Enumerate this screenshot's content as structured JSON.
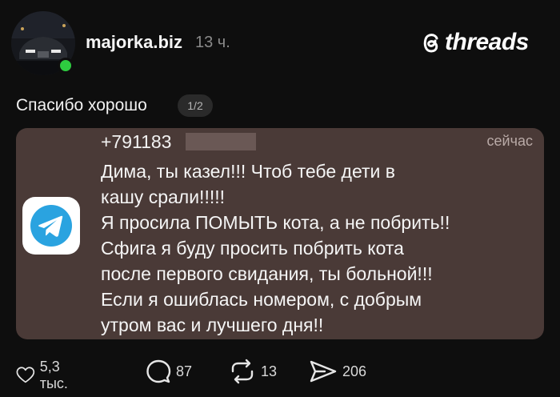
{
  "post": {
    "username": "majorka.biz",
    "time_ago": "13 ч.",
    "text": "Спасибо хорошо",
    "page_indicator": "1/2"
  },
  "brand": {
    "name": "threads"
  },
  "notification": {
    "app_icon": "telegram-icon",
    "sender": "+791183",
    "time": "сейчас",
    "message_lines": [
      "Дима, ты казел!!! Чтоб тебе дети в",
      "кашу срали!!!!!",
      "Я просила ПОМЫТЬ кота, а не побрить!!",
      "Сфига я буду просить побрить кота",
      "после первого свидания, ты больной!!!",
      "Если я ошиблась номером, с добрым",
      "утром вас и лучшего дня!!"
    ],
    "background_color": "#4a3a37"
  },
  "actions": {
    "likes": "5,3 тыс.",
    "comments": "87",
    "reposts": "13",
    "shares": "206"
  },
  "colors": {
    "online": "#2ecc40",
    "telegram": "#2aa3e0"
  }
}
